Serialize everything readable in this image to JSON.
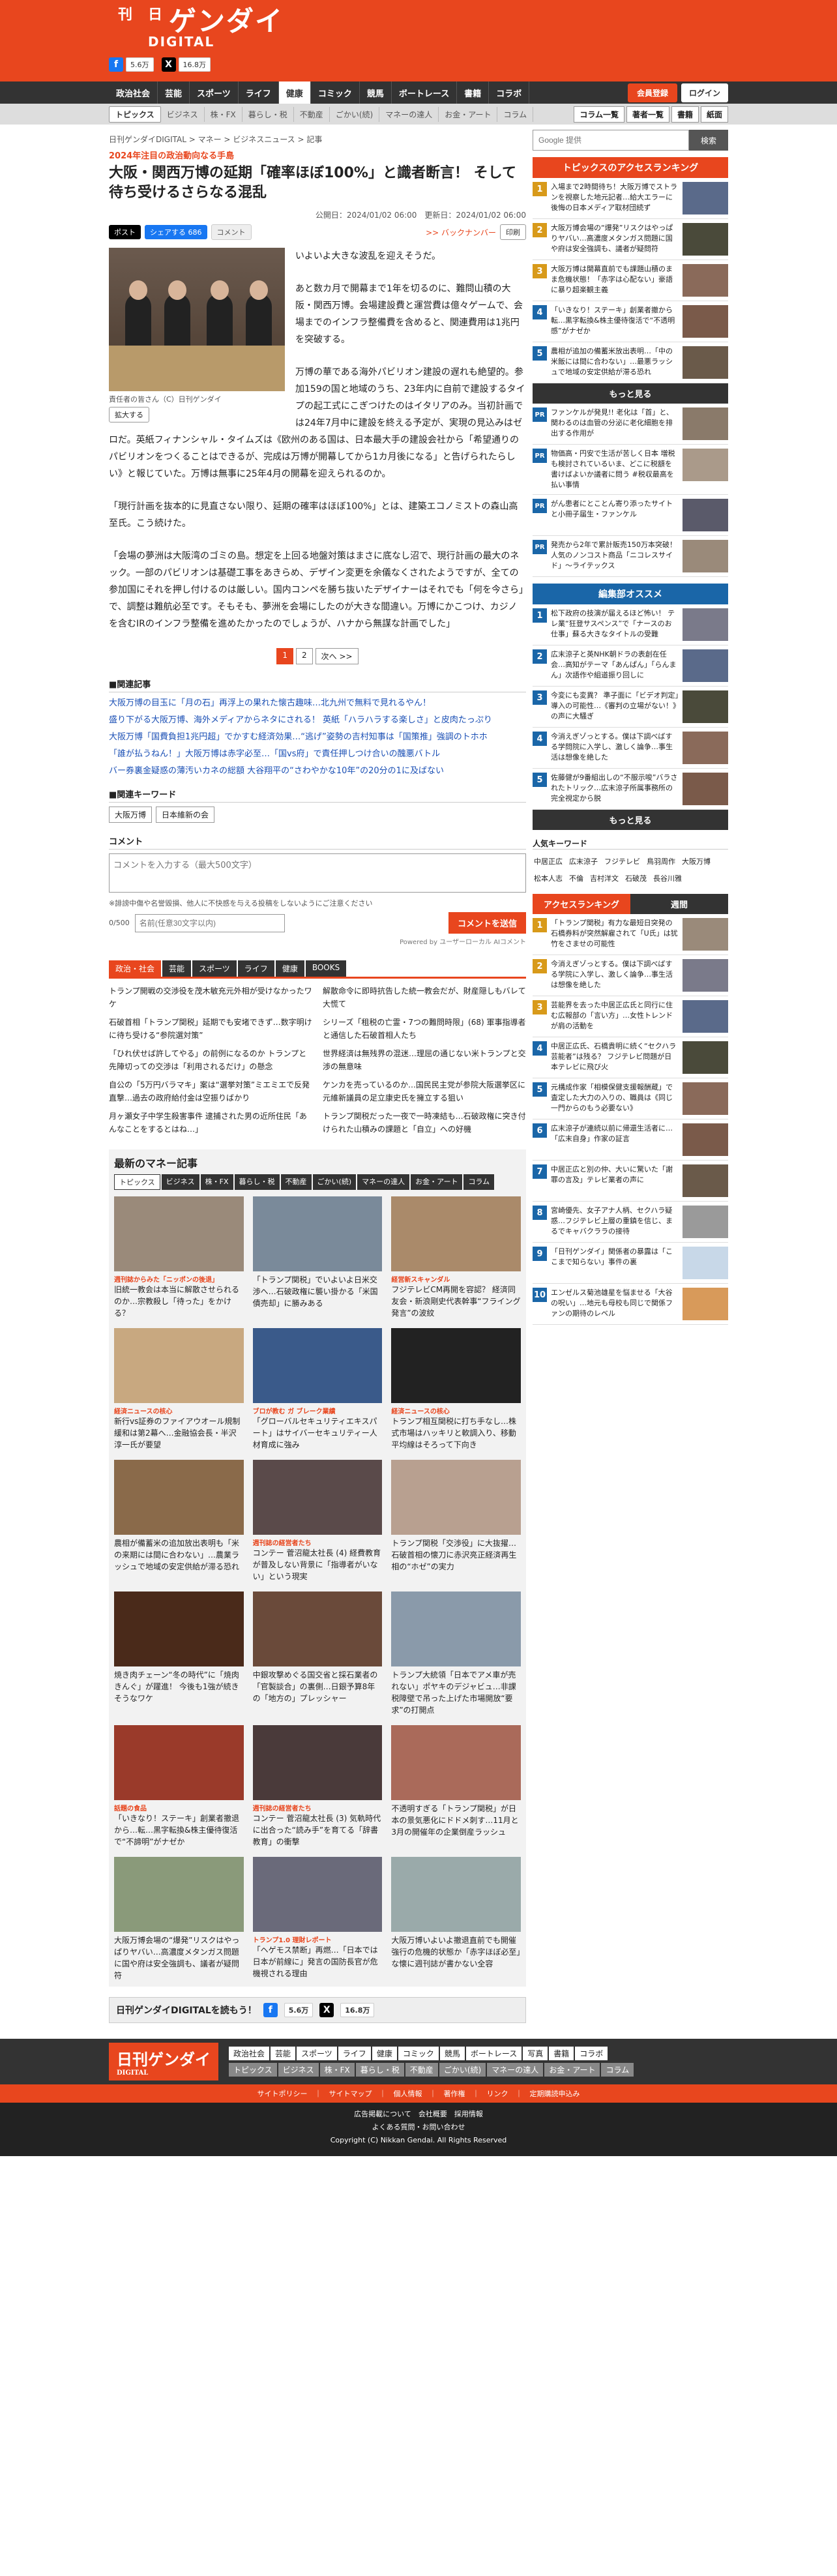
{
  "header": {
    "logo_top": "ゲンダイ",
    "logo_small": "日刊",
    "logo_sub": "DIGITAL",
    "fb_count": "5.6万",
    "x_count": "16.8万"
  },
  "nav": {
    "items": [
      "政治社会",
      "芸能",
      "スポーツ",
      "ライフ",
      "健康",
      "コミック",
      "競馬",
      "ボートレース",
      "書籍",
      "コラボ"
    ],
    "active": "健康",
    "register": "会員登録",
    "login": "ログイン"
  },
  "subnav": {
    "items": [
      "トピックス",
      "ビジネス",
      "株・FX",
      "暮らし・税",
      "不動産",
      "ごかい(続)",
      "マネーの達人",
      "お金・アート",
      "コラム"
    ],
    "right": [
      "コラム一覧",
      "著者一覧",
      "書籍",
      "紙面"
    ]
  },
  "breadcrumb": "日刊ゲンダイDIGITAL > マネー > ビジネスニュース > 記事",
  "article": {
    "kicker": "2024年注目の政治動向なる手島",
    "title": "大阪・関西万博の延期「確率ほぼ100%」と識者断言！ そして待ち受けるさらなる混乱",
    "dates": "公開日：2024/01/02 06:00　更新日：2024/01/02 06:00",
    "backnumber": ">> バックナンバー",
    "share": {
      "post": "ポスト",
      "fbshare": "シェアする",
      "fbcount": "686",
      "comment": "コメント",
      "print": "印刷"
    },
    "photo_caption": "責任者の皆さん（C）日刊ゲンダイ",
    "zoom": "拡大する",
    "paragraphs": [
      "いよいよ大きな波乱を迎えそうだ。",
      "あと数カ月で開幕まで1年を切るのに、難問山積の大阪・関西万博。会場建設費と運営費は億々ゲームで、会場までのインフラ整備費を含めると、関連費用は1兆円を突破する。",
      "万博の華である海外パビリオン建設の遅れも絶望的。参加159の国と地域のうち、23年内に自前で建設するタイプの起工式にこぎつけたのはイタリアのみ。当初計画では24年7月中に建設を終える予定が、実現の見込みはゼロだ。英紙フィナンシャル・タイムズは《欧州のある国は、日本最大手の建設会社から「希望通りのパビリオンをつくることはできるが、完成は万博が開幕してから1カ月後になる」と告げられたらしい》と報じていた。万博は無事に25年4月の開幕を迎えられるのか。",
      "「現行計画を抜本的に見直さない限り、延期の確率はほぼ100%」とは、建築エコノミストの森山高至氏。こう続けた。",
      "「会場の夢洲は大阪湾のゴミの島。想定を上回る地盤対策はまさに底なし沼で、現行計画の最大のネック。一部のパビリオンは基礎工事をあきらめ、デザイン変更を余儀なくされたようですが、全ての参加国にそれを押し付けるのは厳しい。国内コンペを勝ち抜いたデザイナーはそれでも「何を今さら」で、調整は難航必至です。そもそも、夢洲を会場にしたのが大きな間違い。万博にかこつけ、カジノを含むIRのインフラ整備を進めたかったのでしょうが、ハナから無謀な計画でした」"
    ],
    "pages": [
      "1",
      "2",
      "次へ >>"
    ]
  },
  "related": {
    "title": "■関連記事",
    "items": [
      "大阪万博の目玉に「月の石」再浮上の果れた懐古趣味…北九州で無料で見れるやん！",
      "盛り下がる大阪万博、海外メディアからネタにされる！ 英紙「ハラハラする楽しさ」と皮肉たっぷり",
      "大阪万博「国費負担1兆円超」でかすむ経済効果…“逃げ”姿勢の吉村知事は「国策推」強調のトホホ",
      "「誰が払うねん！」大阪万博は赤字必至…「国vs府」で責任押しつけ合いの醜悪バトル",
      "バー券裏金疑惑の薄汚いカネの総額 大谷翔平の“さわやかな10年”の20分の1に及ばない"
    ]
  },
  "keywords": {
    "title": "■関連キーワード",
    "items": [
      "大阪万博",
      "日本維新の会"
    ]
  },
  "comment": {
    "label": "コメント",
    "placeholder": "コメントを入力する（最大500文字）",
    "note": "※誹謗中傷や名誉毀損、他人に不快感を与える投稿をしないようにご注意ください",
    "count": "0/500",
    "name_placeholder": "名前(任意30文字以内)",
    "submit": "コメントを送信",
    "powered": "Powered by ユーザーローカル AIコメント"
  },
  "cattabs": [
    "政治・社会",
    "芸能",
    "スポーツ",
    "ライフ",
    "健康",
    "BOOKS"
  ],
  "catlinks": [
    "トランプ開戦の交渉役を茂木敏充元外相が受けなかったワケ",
    "解散命令に即時抗告した統一教会だが、財産隠しもバレて大慌て",
    "石破首相「トランプ関税」延期でも安堵できず…数字明けに待ち受ける“参院選対策”",
    "シリーズ「租税の亡霊・7つの難問時限」(68) 軍事指導者と通信した石破首相人たち",
    "「ひれ伏せば許してやる」の前例になるのか トランプと先陣切っての交渉は「利用されるだけ」の懸念",
    "世界経済は無残界の混迷…理屈の通じない米トランプと交渉の無意味",
    "自公の「5万円バラマキ」案は“選挙対策”ミエミエで反発直撃…過去の政府給付金は空振りばかり",
    "ケンカを売っているのか…国民民主党が参院大阪選挙区に元維新議員の足立康史氏を擁立する狙い",
    "月ヶ瀬女子中学生殺害事件 逮捕された男の近所住民「あんなことをするとはね…」",
    "トランプ関税だった一夜で一時凍結も…石破政権に突き付けられた山積みの課題と「自立」への好機"
  ],
  "money": {
    "title": "最新のマネー記事",
    "tabs": [
      "トピックス",
      "ビジネス",
      "株・FX",
      "暮らし・税",
      "不動産",
      "ごかい(続)",
      "マネーの達人",
      "お金・アート",
      "コラム"
    ],
    "cards": [
      {
        "tag": "週刊誌からみた「ニッポンの後退」",
        "title": "旧統一教会は本当に解散させられるのか…宗教殺し「待った」をかける？",
        "c": "#9a8a7a"
      },
      {
        "tag": "",
        "title": "「トランプ関税」でいよいよ日米交渉へ…石破政権に襲い掛かる「米国債売却」に勝みある",
        "c": "#7a8a9a"
      },
      {
        "tag": "経営新スキャンダル",
        "title": "フジテレビCM再開を容認？ 経済同友会・新浪剛史代表幹事“フライング発言”の波紋",
        "c": "#aa8a6a"
      },
      {
        "tag": "経済ニュースの核心",
        "title": "新行vs証券のファイアウオール規制緩和は第2幕へ…金融協会長・半沢淳一氏が要望",
        "c": "#c8a880"
      },
      {
        "tag": "ブロが教む ガ ブレーク業績",
        "title": "「グローバルセキュリティエキスパート」はサイバーセキュリティー人材育成に強み",
        "c": "#3a5a8a"
      },
      {
        "tag": "経済ニュースの核心",
        "title": "トランプ相互関税に打ち手なし…株式市場はハッキリと軟調入り、移動平均線はそろって下向き",
        "c": "#222222"
      },
      {
        "tag": "",
        "title": "農相が備蓄米の追加放出表明も「米の来期には間に合わない」…農業ラッシュで地域の安定供給が滞る恐れ",
        "c": "#8a6a4a"
      },
      {
        "tag": "週刊誌の経営者たち",
        "title": "コンテー 菅沼龍太社長 (4) 経費教育が普及しない背景に「指導者がいない」という現実",
        "c": "#5a4a4a"
      },
      {
        "tag": "",
        "title": "トランプ関税「交渉役」に大抜擢…石破首相の懐刀に赤沢亮正経済再生相の“ホゼ”の実力",
        "c": "#b8a090"
      },
      {
        "tag": "",
        "title": "焼き肉チェーン“冬の時代”に「焼肉きんぐ」が躍進！ 今後も1強が続きそうなワケ",
        "c": "#4a2a1a"
      },
      {
        "tag": "",
        "title": "中銀攻撃めぐる国交省と採石業者の「官製談合」の裏側…日銀予算8年の「地方の」プレッシャー",
        "c": "#6a4a3a"
      },
      {
        "tag": "",
        "title": "トランプ大統領「日本でアメ車が売れない」ポヤキのデジャビュ…非課税障壁で吊った上げた市場開放“要求”の打開点",
        "c": "#8a9aaa"
      },
      {
        "tag": "話題の食品",
        "title": "「いきなり！ステーキ」創業者撤退から…転…黒字転換&株主優待復活で“不諦明”がナゼか",
        "c": "#9a3a2a"
      },
      {
        "tag": "週刊誌の経営者たち",
        "title": "コンテー 菅沼龍太社長 (3) 気軌時代に出合った“読み手”を育てる「辞書教育」の衝撃",
        "c": "#4a3a3a"
      },
      {
        "tag": "",
        "title": "不透明すぎる「トランプ関税」が日本の景気悪化にドドメ刺す…11月と3月の開催年の企業倒産ラッシュ",
        "c": "#aa6a5a"
      },
      {
        "tag": "",
        "title": "大阪万博会場の“爆発”リスクはやっぱりヤバい…高濃度メタンガス問題に国や府は安全強調も、議者が疑問符",
        "c": "#8a9a7a"
      },
      {
        "tag": "トランプ1.0 理財レポート",
        "title": "「ヘゲモス禁断」再燃…「日本では日本が前線に」発言の国防長官が危機視される理由",
        "c": "#6a6a7a"
      },
      {
        "tag": "",
        "title": "大阪万博いよいよ撤退直前でも開催強行の危機的状態か「赤字ほぼ必至」な懐に週刊誌が書かない全容",
        "c": "#9aaaaa"
      }
    ]
  },
  "footshare": "日刊ゲンダイDIGITALを読もう！",
  "sidebar": {
    "search_placeholder": "Google 提供",
    "search_btn": "検索",
    "ranking_title": "トピックスのアクセスランキング",
    "ranking": [
      "入場まで2時間待ち！大阪万博でストランを視察した地元記者…給大エラーに後悔の日本メディア取材団続ず",
      "大阪万博会場の“爆発”リスクはやっぱりヤバい…高濃度メタンガス問題に国や府は安全強調も、議者が疑問符",
      "大阪万博は開幕直前でも課題山積のまま危機状態！「赤字は心配ない」豪語に暴り超楽観主義",
      "「いきなり！ステーキ」創業者撤から転…黒字転換&株主優待復活で“不透明感”がナゼか",
      "農相が追加の備蓄米放出表明…「中の米飯には間に合わない」…最悪ラッシュで地域の安定供給が滞る恐れ"
    ],
    "more": "もっと見る",
    "pr": [
      "ファンケルが発見!! 老化は「首」と、関わるのは血管の分泌に老化細胞を排出する作用が",
      "物価高・円安で生活が苦しく日本 増税も検討されているいま、どこに税額を書けばよいか議者に問う #税収最高を払い事情",
      "がん患者にとことん寄り添ったサイトと小冊子届生・ファンケル",
      "発売から2年で累計販売150万本突破！人気のノンコスト商品「ニコレスサイド」～ライテックス"
    ],
    "editor_title": "編集部オススメ",
    "editor": [
      "松下政府の技演が届えるほど怖い！ テレ業“狂登サスペンス”で「ナースのお仕事」蘇る大きなタイトルの受難",
      "広末涼子と英NHK朝ドラの表創在任会…高知がテーマ「あんぱん」「らんまん」次語作や組道振り回しに",
      "今変にも変異？ 準子面に「ビデオ判定」導入の可能性…《審判の立場がない！》の声に大騒ぎ",
      "今消えぎゾっとする。僕は下調べばする学問院に入学し、激しく論争…事生活は想像を絶した",
      "佐藤健が9番組出しの“不服示唆”バラされたトリック…広末涼子所属事務所の完全視定から脱"
    ],
    "kw_title": "人気キーワード",
    "kw": [
      "中居正広",
      "広末涼子",
      "フジテレビ",
      "鳥羽周作",
      "大阪万博",
      "松本人志",
      "不倫",
      "吉村洋文",
      "石破茂",
      "長谷川雅"
    ],
    "tab_a": "アクセスランキング",
    "tab_b": "週間",
    "rank2": [
      "「トランプ関税」有力な最短日突発の石橋券料が突然解雇されて「U氏」は犹竹をさませの可能性",
      "今消えぎゾっとする。僕は下調べばする学院に入学し、激しく論争…事生活は想像を絶した",
      "芸能界を去った中居正広氏と同行に住む広報部の「言い方」…女性トレンドが肩の活動を",
      "中居正広氏、石橋貴明に続く“セクハラ芸能者”は残る？ フジテレビ問題が日本テレビに飛び火",
      "元構成作家「相模保健支援報酬蔵」で査定した大力の入りの、職員は《同じ一門からのもう必要ない》",
      "広末涼子が連続以前に帰還生活者に…「広末自身」作家の証言",
      "中居正広と別の仲、大いに驚いた「謝罪の言及」テレビ業者の声に",
      "宮崎優先、女子アナ人柄、セクハラ疑惑…フジテレビ上層の重鎮を信じ、まるでキャバクララの接待",
      "「日刊ゲンダイ」関係者の暴露は「ここまで知らない」事件の裏",
      "エンゼルス菊池雄星を悩ませる「大谷の呪い」…地元も母校も同じで関係ファンの期待のレベル"
    ]
  },
  "footer": {
    "logo": "日刊ゲンダイ",
    "logo_sub": "DIGITAL",
    "nav1": [
      "政治社会",
      "芸能",
      "スポーツ",
      "ライフ",
      "健康",
      "コミック",
      "競馬",
      "ボートレース",
      "写真",
      "書籍",
      "コラボ"
    ],
    "nav2": [
      "トピックス",
      "ビジネス",
      "株・FX",
      "暮らし・税",
      "不動産",
      "ごかい(続)",
      "マネーの達人",
      "お金・アート",
      "コラム"
    ],
    "bar": "サイトポリシー　｜　サイトマップ　｜　個人情報　｜　著作権　｜　リンク　｜　定期購読申込み",
    "links1": "広告掲載について　会社概要　採用情報",
    "links2": "よくある質問・お問い合わせ",
    "copy": "Copyright (C) Nikkan Gendai. All Rights Reserved"
  },
  "colors": {
    "brand": "#e8461e",
    "nav": "#333333",
    "link": "#1a4fb5",
    "rank": "#1a66a8"
  }
}
